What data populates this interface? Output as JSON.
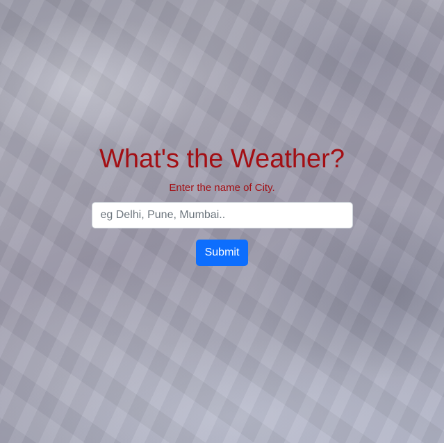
{
  "header": {
    "title": "What's the Weather?",
    "subtitle": "Enter the name of City."
  },
  "search": {
    "value": "",
    "placeholder": "eg Delhi, Pune, Mumbai.."
  },
  "form": {
    "submit_label": "Submit"
  },
  "colors": {
    "heading": "#a30f14",
    "button": "#0d6efd"
  }
}
